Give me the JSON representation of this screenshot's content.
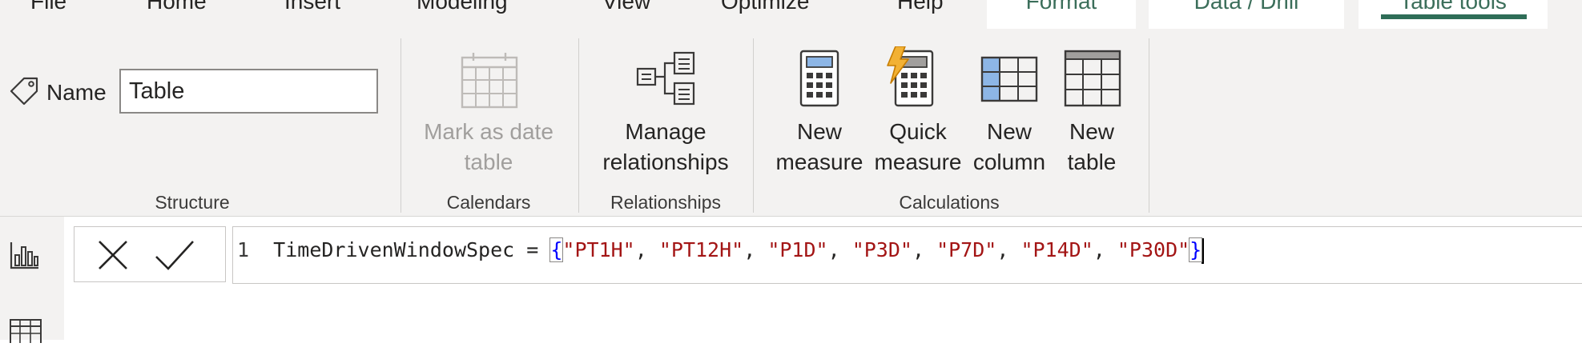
{
  "tabs": [
    {
      "label": "File"
    },
    {
      "label": "Home"
    },
    {
      "label": "Insert"
    },
    {
      "label": "Modeling"
    },
    {
      "label": "View"
    },
    {
      "label": "Optimize"
    },
    {
      "label": "Help"
    },
    {
      "label": "Format"
    },
    {
      "label": "Data / Drill"
    },
    {
      "label": "Table tools"
    }
  ],
  "active_tab": "Table tools",
  "structure": {
    "name_label": "Name",
    "name_value": "Table",
    "group_label": "Structure"
  },
  "calendars": {
    "mark_label_1": "Mark as date",
    "mark_label_2": "table",
    "group_label": "Calendars"
  },
  "relationships": {
    "manage_label_1": "Manage",
    "manage_label_2": "relationships",
    "group_label": "Relationships"
  },
  "calculations": {
    "new_measure_1": "New",
    "new_measure_2": "measure",
    "quick_measure_1": "Quick",
    "quick_measure_2": "measure",
    "new_column_1": "New",
    "new_column_2": "column",
    "new_table_1": "New",
    "new_table_2": "table",
    "group_label": "Calculations"
  },
  "formula": {
    "line_number": "1",
    "name": "TimeDrivenWindowSpec",
    "equals": " = ",
    "open_brace": "{",
    "close_brace": "}",
    "values": [
      "\"PT1H\"",
      "\"PT12H\"",
      "\"P1D\"",
      "\"P3D\"",
      "\"P7D\"",
      "\"P14D\"",
      "\"P30D\""
    ],
    "separator": ", "
  },
  "icons": {
    "tag": "tag-icon",
    "cancel": "x-icon",
    "commit": "check-icon",
    "report_view": "bar-chart-icon",
    "table_view": "table-grid-icon"
  },
  "colors": {
    "accent": "#2e6d57",
    "ribbon_bg": "#f3f2f1",
    "string": "#a31515",
    "brace": "#0000ff"
  }
}
